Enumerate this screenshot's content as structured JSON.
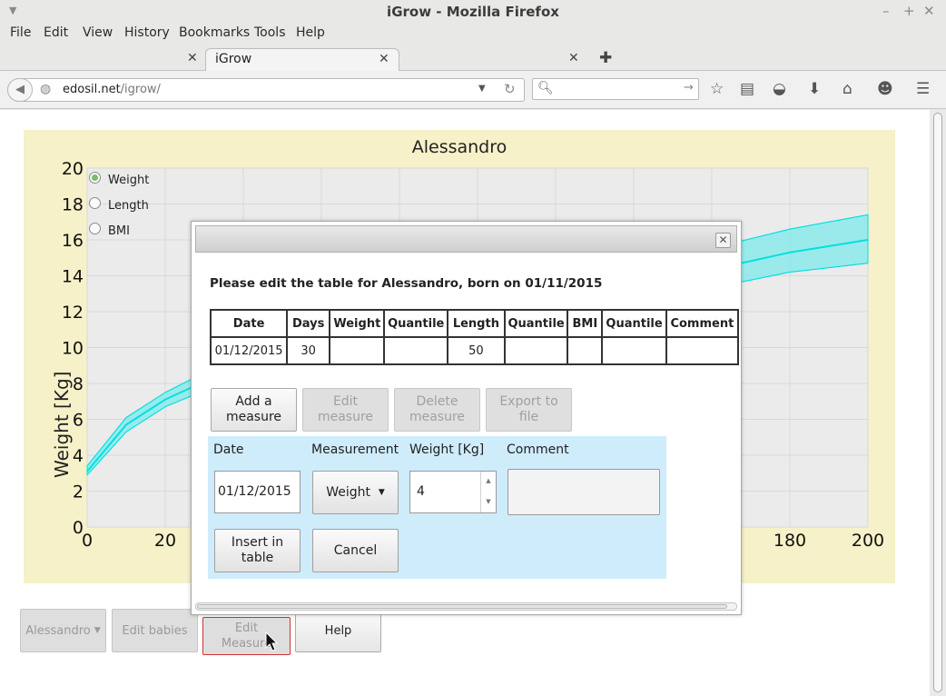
{
  "window": {
    "title": "iGrow - Mozilla Firefox"
  },
  "menu": [
    "File",
    "Edit",
    "View",
    "History",
    "Bookmarks",
    "Tools",
    "Help"
  ],
  "tabs": [
    {
      "label": "iGrow",
      "active": true
    }
  ],
  "address": {
    "host": "edosil.net",
    "path": "/igrow/"
  },
  "search": {
    "placeholder": ""
  },
  "chart_data": {
    "type": "line",
    "title": "Alessandro",
    "xlabel": "",
    "ylabel": "Weight [Kg]",
    "xlim": [
      0,
      200
    ],
    "ylim": [
      0,
      20
    ],
    "x_ticks": [
      0,
      20,
      180,
      200
    ],
    "y_ticks": [
      0,
      2,
      4,
      6,
      8,
      10,
      12,
      14,
      16,
      18,
      20
    ],
    "grid": true,
    "series": [
      {
        "band": "upper",
        "x": [
          0,
          10,
          20,
          30,
          180,
          200
        ],
        "y": [
          3.4,
          6.1,
          7.5,
          8.6,
          16.6,
          17.4
        ]
      },
      {
        "band": "median",
        "x": [
          0,
          10,
          20,
          30,
          180,
          200
        ],
        "y": [
          3.1,
          5.7,
          7.1,
          8.1,
          15.3,
          16.0
        ]
      },
      {
        "band": "lower",
        "x": [
          0,
          10,
          20,
          30,
          180,
          200
        ],
        "y": [
          2.9,
          5.3,
          6.7,
          7.6,
          14.2,
          14.7
        ]
      }
    ],
    "band_color": "#7fe9ec",
    "line_color": "#00e0e0"
  },
  "chart_selector": {
    "options": [
      {
        "label": "Weight",
        "selected": true
      },
      {
        "label": "Length",
        "selected": false
      },
      {
        "label": "BMI",
        "selected": false
      }
    ]
  },
  "bottom_buttons": {
    "baby_select": "Alessandro",
    "edit_babies": "Edit babies",
    "edit_measure": "Edit Measure",
    "help": "Help"
  },
  "dialog": {
    "heading": "Please edit the table for Alessandro, born on 01/11/2015",
    "columns": [
      "Date",
      "Days",
      "Weight",
      "Quantile",
      "Length",
      "Quantile",
      "BMI",
      "Quantile",
      "Comment"
    ],
    "rows": [
      [
        "01/12/2015",
        "30",
        "",
        "",
        "50",
        "",
        "",
        "",
        ""
      ]
    ],
    "actions": {
      "add": "Add a measure",
      "edit": "Edit measure",
      "delete": "Delete measure",
      "export": "Export to file"
    },
    "form": {
      "date_label": "Date",
      "measurement_label": "Measurement",
      "value_label": "Weight [Kg]",
      "comment_label": "Comment",
      "date_value": "01/12/2015",
      "measurement_value": "Weight",
      "value": "4",
      "comment_value": "",
      "insert": "Insert in table",
      "cancel": "Cancel"
    }
  },
  "colors": {
    "chart_background": "#f6f1c8",
    "plot_background": "#ebebeb",
    "form_background": "#cfecfb",
    "focus_border": "#cc3333"
  }
}
